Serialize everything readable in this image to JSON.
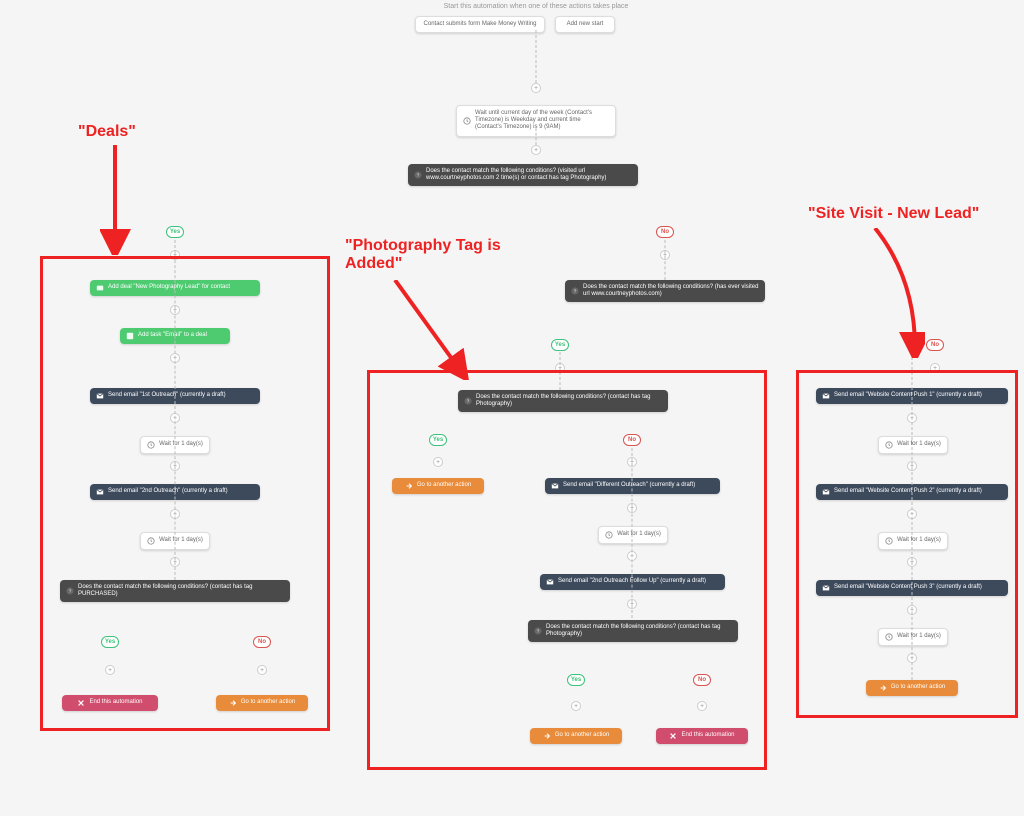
{
  "header": {
    "prompt": "Start this automation when one of these actions takes place",
    "trigger1": "Contact submits form Make Money Writing",
    "trigger2": "Add new start"
  },
  "wait_weekday": "Wait until current day of the week (Contact's Timezone) is Weekday and current time (Contact's Timezone) is 9 (9AM)",
  "cond_main": "Does the contact match the following conditions? (visited url www.courtneyphotos.com 2 time(s) or contact has tag Photography)",
  "cond_visited_ever": "Does the contact match the following conditions? (has ever visited url www.courtneyphotos.com)",
  "cond_photo_tag": "Does the contact match the following conditions? (contact has tag Photography)",
  "cond_photo_tag2": "Does the contact match the following conditions? (contact has tag Photography)",
  "cond_purchased": "Does the contact match the following conditions? (contact has tag PURCHASED)",
  "labels": {
    "yes": "Yes",
    "no": "No"
  },
  "deals": {
    "add_deal": "Add deal \"New Photography Lead\" for contact",
    "add_task": "Add task \"Email\" to a deal",
    "email1": "Send email \"1st Outreach\" (currently a draft)",
    "wait1": "Wait for 1 day(s)",
    "email2": "Send email \"2nd Outreach\" (currently a draft)",
    "wait2": "Wait for 1 day(s)",
    "end": "End this automation",
    "goto": "Go to another action"
  },
  "photo": {
    "goto_top": "Go to another action",
    "email_diff": "Send email \"Different Outreach\" (currently a draft)",
    "wait1": "Wait for 1 day(s)",
    "email_followup": "Send email \"2nd Outreach Follow Up\" (currently a draft)",
    "goto_bottom": "Go to another action",
    "end": "End this automation"
  },
  "site": {
    "email1": "Send email \"Website Content Push 1\" (currently a draft)",
    "wait1": "Wait for 1 day(s)",
    "email2": "Send email \"Website Content Push 2\" (currently a draft)",
    "wait2": "Wait for 1 day(s)",
    "email3": "Send email \"Website Content Push 3\" (currently a draft)",
    "wait3": "Wait for 1 day(s)",
    "goto": "Go to another action"
  },
  "annotations": {
    "deals": "\"Deals\"",
    "photo": "\"Photography Tag is Added\"",
    "site": "\"Site Visit - New Lead\""
  }
}
